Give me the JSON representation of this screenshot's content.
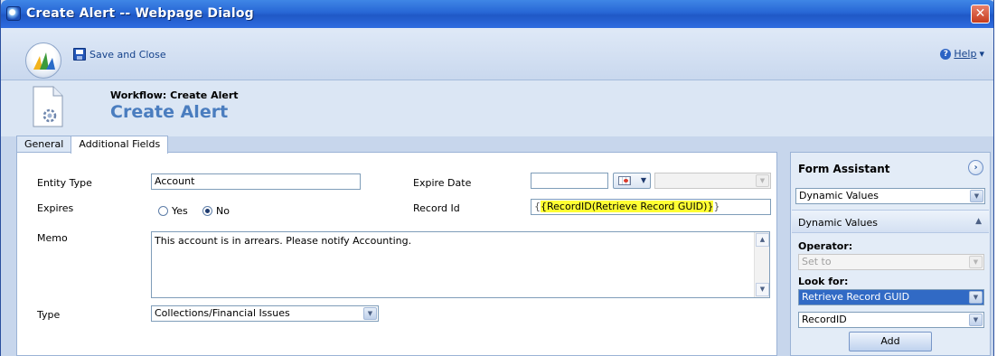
{
  "window": {
    "title": "Create Alert -- Webpage Dialog",
    "close_glyph": "✕"
  },
  "toolbar": {
    "save_close_label": "Save and Close",
    "help_label": "Help",
    "help_caret": "▾"
  },
  "header": {
    "workflow_label": "Workflow: Create Alert",
    "title": "Create Alert"
  },
  "tabs": [
    {
      "label": "General",
      "active": false
    },
    {
      "label": "Additional Fields",
      "active": true
    }
  ],
  "form": {
    "entity_type": {
      "label": "Entity Type",
      "value": "Account"
    },
    "expires": {
      "label": "Expires",
      "options": [
        {
          "label": "Yes",
          "selected": false
        },
        {
          "label": "No",
          "selected": true
        }
      ]
    },
    "memo": {
      "label": "Memo",
      "value": "This account is in arrears.  Please notify Accounting."
    },
    "type": {
      "label": "Type",
      "value": "Collections/Financial Issues"
    },
    "expire_date": {
      "label": "Expire Date",
      "value": ""
    },
    "record_id": {
      "label": "Record Id",
      "open_brace": "{",
      "dynamic_value": "{RecordID(Retrieve Record GUID)}",
      "close_brace": "}"
    }
  },
  "form_assistant": {
    "title": "Form Assistant",
    "collapse_glyph": "›",
    "category_select": "Dynamic Values",
    "section_label": "Dynamic Values",
    "section_toggle": "▲",
    "operator_label": "Operator:",
    "operator_value": "Set to",
    "look_for_label": "Look for:",
    "look_for_value": "Retrieve Record GUID",
    "attribute_value": "RecordID",
    "add_label": "Add"
  },
  "colors": {
    "title_bar": "#2766d5",
    "accent_title": "#4a7dbf",
    "dynamic_highlight": "#ffff33",
    "selected_row": "#316ac5"
  }
}
